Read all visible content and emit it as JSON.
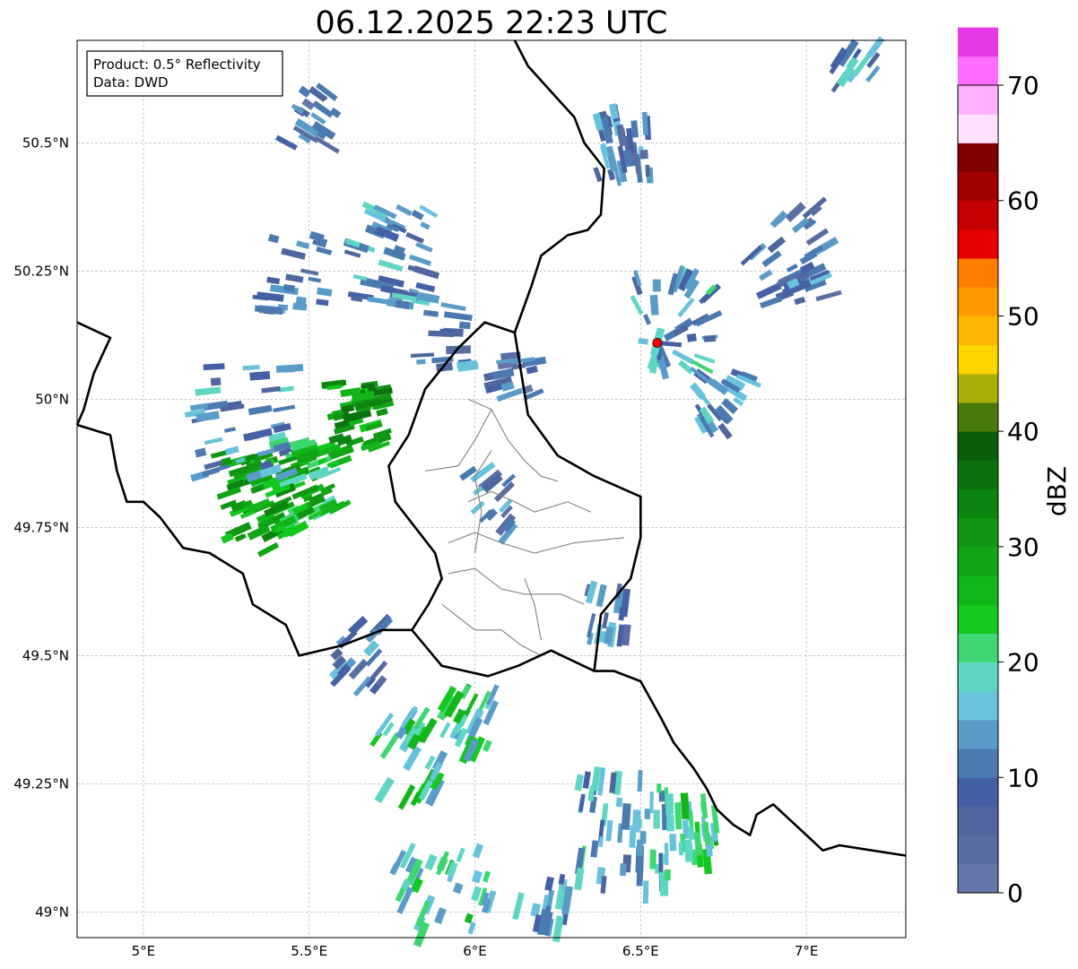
{
  "title": "06.12.2025 22:23 UTC",
  "info_box": {
    "line1": "Product: 0.5° Reflectivity",
    "line2": "Data: DWD"
  },
  "map": {
    "lon_range": [
      4.8,
      7.3
    ],
    "lat_range": [
      48.95,
      50.7
    ],
    "x_ticks": [
      {
        "v": 5.0,
        "label": "5°E"
      },
      {
        "v": 5.5,
        "label": "5.5°E"
      },
      {
        "v": 6.0,
        "label": "6°E"
      },
      {
        "v": 6.5,
        "label": "6.5°E"
      },
      {
        "v": 7.0,
        "label": "7°E"
      }
    ],
    "y_ticks": [
      {
        "v": 49.0,
        "label": "49°N"
      },
      {
        "v": 49.25,
        "label": "49.25°N"
      },
      {
        "v": 49.5,
        "label": "49.5°N"
      },
      {
        "v": 49.75,
        "label": "49.75°N"
      },
      {
        "v": 50.0,
        "label": "50°N"
      },
      {
        "v": 50.25,
        "label": "50.25°N"
      },
      {
        "v": 50.5,
        "label": "50.5°N"
      }
    ],
    "radar_site": {
      "lon": 6.55,
      "lat": 50.11,
      "color": "#ff0000"
    },
    "country_borders": [
      [
        [
          4.8,
          50.15
        ],
        [
          4.9,
          50.12
        ],
        [
          4.85,
          50.05
        ],
        [
          4.82,
          49.98
        ],
        [
          4.8,
          49.95
        ]
      ],
      [
        [
          4.8,
          49.95
        ],
        [
          4.9,
          49.93
        ],
        [
          4.92,
          49.86
        ],
        [
          4.95,
          49.8
        ],
        [
          5.0,
          49.8
        ],
        [
          5.05,
          49.77
        ],
        [
          5.12,
          49.71
        ],
        [
          5.2,
          49.7
        ],
        [
          5.3,
          49.66
        ],
        [
          5.33,
          49.6
        ],
        [
          5.43,
          49.56
        ],
        [
          5.47,
          49.5
        ],
        [
          5.6,
          49.52
        ],
        [
          5.72,
          49.55
        ],
        [
          5.81,
          49.55
        ],
        [
          5.9,
          49.48
        ],
        [
          6.04,
          49.46
        ],
        [
          6.13,
          49.48
        ],
        [
          6.23,
          49.51
        ],
        [
          6.36,
          49.47
        ],
        [
          6.42,
          49.47
        ],
        [
          6.5,
          49.45
        ],
        [
          6.56,
          49.38
        ],
        [
          6.6,
          49.33
        ],
        [
          6.66,
          49.28
        ],
        [
          6.7,
          49.24
        ],
        [
          6.73,
          49.2
        ],
        [
          6.78,
          49.17
        ],
        [
          6.83,
          49.15
        ],
        [
          6.85,
          49.19
        ],
        [
          6.9,
          49.21
        ],
        [
          6.95,
          49.18
        ],
        [
          7.0,
          49.15
        ],
        [
          7.05,
          49.12
        ],
        [
          7.1,
          49.13
        ],
        [
          7.2,
          49.12
        ],
        [
          7.3,
          49.11
        ]
      ],
      [
        [
          5.81,
          49.55
        ],
        [
          5.86,
          49.6
        ],
        [
          5.9,
          49.65
        ],
        [
          5.88,
          49.7
        ],
        [
          5.82,
          49.75
        ],
        [
          5.76,
          49.8
        ],
        [
          5.74,
          49.87
        ],
        [
          5.8,
          49.93
        ],
        [
          5.85,
          50.02
        ],
        [
          5.95,
          50.1
        ],
        [
          6.03,
          50.15
        ],
        [
          6.12,
          50.13
        ],
        [
          6.14,
          50.05
        ],
        [
          6.16,
          49.97
        ],
        [
          6.25,
          49.89
        ],
        [
          6.36,
          49.85
        ],
        [
          6.5,
          49.81
        ],
        [
          6.5,
          49.73
        ],
        [
          6.47,
          49.65
        ],
        [
          6.38,
          49.58
        ],
        [
          6.36,
          49.47
        ]
      ],
      [
        [
          6.12,
          50.13
        ],
        [
          6.17,
          50.22
        ],
        [
          6.2,
          50.28
        ],
        [
          6.28,
          50.32
        ],
        [
          6.34,
          50.33
        ],
        [
          6.38,
          50.36
        ],
        [
          6.39,
          50.45
        ],
        [
          6.33,
          50.5
        ],
        [
          6.3,
          50.55
        ],
        [
          6.23,
          50.6
        ],
        [
          6.16,
          50.65
        ],
        [
          6.12,
          50.7
        ]
      ]
    ],
    "admin_borders": [
      [
        [
          5.98,
          50.0
        ],
        [
          6.05,
          49.98
        ],
        [
          6.0,
          49.92
        ],
        [
          5.95,
          49.87
        ],
        [
          5.85,
          49.86
        ]
      ],
      [
        [
          6.05,
          49.98
        ],
        [
          6.1,
          49.92
        ],
        [
          6.15,
          49.88
        ],
        [
          6.2,
          49.85
        ],
        [
          6.25,
          49.84
        ]
      ],
      [
        [
          5.98,
          49.8
        ],
        [
          6.05,
          49.82
        ],
        [
          6.12,
          49.8
        ],
        [
          6.18,
          49.78
        ],
        [
          6.28,
          49.8
        ],
        [
          6.35,
          49.78
        ]
      ],
      [
        [
          5.92,
          49.72
        ],
        [
          6.0,
          49.74
        ],
        [
          6.08,
          49.72
        ],
        [
          6.18,
          49.7
        ],
        [
          6.3,
          49.72
        ],
        [
          6.45,
          49.73
        ]
      ],
      [
        [
          5.92,
          49.66
        ],
        [
          6.0,
          49.67
        ],
        [
          6.08,
          49.63
        ],
        [
          6.15,
          49.62
        ],
        [
          6.26,
          49.62
        ],
        [
          6.33,
          49.6
        ]
      ],
      [
        [
          5.9,
          49.6
        ],
        [
          6.0,
          49.55
        ],
        [
          6.08,
          49.55
        ],
        [
          6.14,
          49.52
        ],
        [
          6.2,
          49.5
        ]
      ],
      [
        [
          6.05,
          49.9
        ],
        [
          6.0,
          49.85
        ],
        [
          6.02,
          49.78
        ],
        [
          6.0,
          49.7
        ]
      ],
      [
        [
          6.15,
          49.65
        ],
        [
          6.18,
          49.6
        ],
        [
          6.2,
          49.53
        ]
      ]
    ],
    "echo_clusters": [
      {
        "lon": 5.35,
        "lat": 49.8,
        "intensity": 28,
        "spread": 0.12,
        "count": 60
      },
      {
        "lon": 5.5,
        "lat": 49.85,
        "intensity": 26,
        "spread": 0.1,
        "count": 50
      },
      {
        "lon": 5.65,
        "lat": 49.97,
        "intensity": 30,
        "spread": 0.08,
        "count": 45
      },
      {
        "lon": 5.3,
        "lat": 49.95,
        "intensity": 12,
        "spread": 0.15,
        "count": 40
      },
      {
        "lon": 5.75,
        "lat": 50.28,
        "intensity": 12,
        "spread": 0.12,
        "count": 45
      },
      {
        "lon": 5.45,
        "lat": 50.25,
        "intensity": 8,
        "spread": 0.1,
        "count": 25
      },
      {
        "lon": 5.5,
        "lat": 50.55,
        "intensity": 8,
        "spread": 0.08,
        "count": 18
      },
      {
        "lon": 6.45,
        "lat": 50.5,
        "intensity": 10,
        "spread": 0.08,
        "count": 35
      },
      {
        "lon": 6.6,
        "lat": 50.15,
        "intensity": 14,
        "spread": 0.12,
        "count": 40
      },
      {
        "lon": 6.95,
        "lat": 50.28,
        "intensity": 10,
        "spread": 0.12,
        "count": 35
      },
      {
        "lon": 6.75,
        "lat": 50.0,
        "intensity": 12,
        "spread": 0.08,
        "count": 25
      },
      {
        "lon": 6.12,
        "lat": 50.05,
        "intensity": 8,
        "spread": 0.06,
        "count": 15
      },
      {
        "lon": 6.03,
        "lat": 49.8,
        "intensity": 10,
        "spread": 0.08,
        "count": 15
      },
      {
        "lon": 6.4,
        "lat": 49.58,
        "intensity": 10,
        "spread": 0.06,
        "count": 18
      },
      {
        "lon": 5.8,
        "lat": 49.3,
        "intensity": 20,
        "spread": 0.1,
        "count": 30
      },
      {
        "lon": 5.98,
        "lat": 49.37,
        "intensity": 20,
        "spread": 0.08,
        "count": 25
      },
      {
        "lon": 6.45,
        "lat": 49.15,
        "intensity": 14,
        "spread": 0.14,
        "count": 50
      },
      {
        "lon": 6.65,
        "lat": 49.15,
        "intensity": 22,
        "spread": 0.08,
        "count": 30
      },
      {
        "lon": 5.9,
        "lat": 49.0,
        "intensity": 20,
        "spread": 0.15,
        "count": 50
      },
      {
        "lon": 6.2,
        "lat": 49.0,
        "intensity": 14,
        "spread": 0.08,
        "count": 20
      },
      {
        "lon": 5.65,
        "lat": 49.5,
        "intensity": 10,
        "spread": 0.08,
        "count": 20
      },
      {
        "lon": 5.9,
        "lat": 50.12,
        "intensity": 10,
        "spread": 0.08,
        "count": 15
      },
      {
        "lon": 7.15,
        "lat": 50.65,
        "intensity": 12,
        "spread": 0.06,
        "count": 12
      }
    ]
  },
  "colorbar": {
    "label": "dBZ",
    "min": 0,
    "max": 70,
    "step": 2.5,
    "tick_labels": [
      {
        "v": 0,
        "label": "0"
      },
      {
        "v": 10,
        "label": "10"
      },
      {
        "v": 20,
        "label": "20"
      },
      {
        "v": 30,
        "label": "30"
      },
      {
        "v": 40,
        "label": "40"
      },
      {
        "v": 50,
        "label": "50"
      },
      {
        "v": 60,
        "label": "60"
      },
      {
        "v": 70,
        "label": "70"
      }
    ],
    "colors": [
      "#6577aa",
      "#5a6ea3",
      "#4f679e",
      "#4560a5",
      "#4a7ab0",
      "#5a9cc8",
      "#68c2dc",
      "#5fd6c4",
      "#3dd670",
      "#13c81f",
      "#12b51a",
      "#11a515",
      "#109612",
      "#0d8410",
      "#0b720d",
      "#0a5e0b",
      "#487a0c",
      "#a9b008",
      "#ffd500",
      "#ffb600",
      "#ff9a00",
      "#ff7e00",
      "#e60000",
      "#c60000",
      "#a20000",
      "#800000",
      "#ffe0ff",
      "#ffb0ff",
      "#ff6cff",
      "#e839e8"
    ]
  }
}
